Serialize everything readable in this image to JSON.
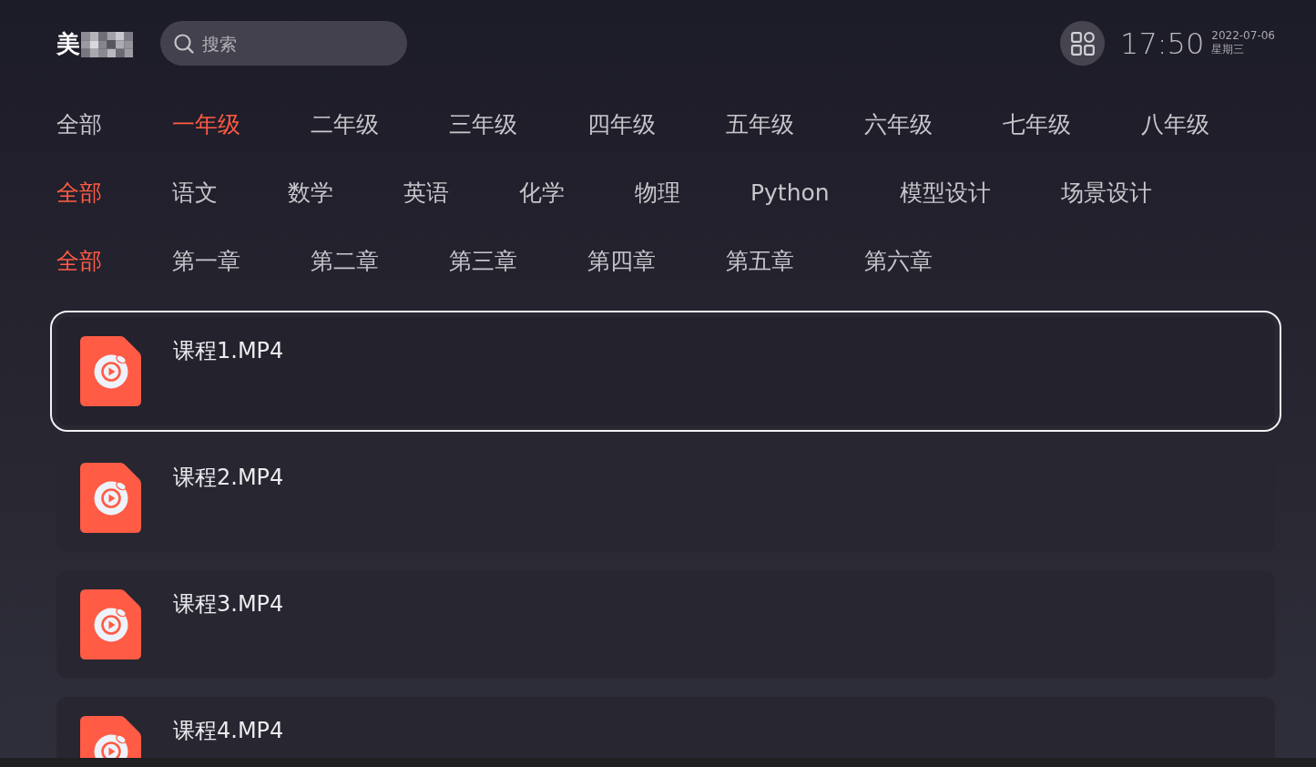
{
  "header": {
    "logo": "美",
    "search": {
      "placeholder": "搜索"
    },
    "clock": {
      "time": "17:50",
      "date": "2022-07-06",
      "weekday": "星期三"
    }
  },
  "filters": [
    {
      "items": [
        {
          "label": "全部",
          "selected": false
        },
        {
          "label": "一年级",
          "selected": true
        },
        {
          "label": "二年级",
          "selected": false
        },
        {
          "label": "三年级",
          "selected": false
        },
        {
          "label": "四年级",
          "selected": false
        },
        {
          "label": "五年级",
          "selected": false
        },
        {
          "label": "六年级",
          "selected": false
        },
        {
          "label": "七年级",
          "selected": false
        },
        {
          "label": "八年级",
          "selected": false
        }
      ]
    },
    {
      "items": [
        {
          "label": "全部",
          "selected": true
        },
        {
          "label": "语文",
          "selected": false
        },
        {
          "label": "数学",
          "selected": false
        },
        {
          "label": "英语",
          "selected": false
        },
        {
          "label": "化学",
          "selected": false
        },
        {
          "label": "物理",
          "selected": false
        },
        {
          "label": "Python",
          "selected": false
        },
        {
          "label": "模型设计",
          "selected": false
        },
        {
          "label": "场景设计",
          "selected": false
        }
      ]
    },
    {
      "items": [
        {
          "label": "全部",
          "selected": true
        },
        {
          "label": "第一章",
          "selected": false
        },
        {
          "label": "第二章",
          "selected": false
        },
        {
          "label": "第三章",
          "selected": false
        },
        {
          "label": "第四章",
          "selected": false
        },
        {
          "label": "第五章",
          "selected": false
        },
        {
          "label": "第六章",
          "selected": false
        }
      ]
    }
  ],
  "courses": [
    {
      "title": "课程1.MP4",
      "selected": true
    },
    {
      "title": "课程2.MP4",
      "selected": false
    },
    {
      "title": "课程3.MP4",
      "selected": false
    },
    {
      "title": "课程4.MP4",
      "selected": false
    }
  ]
}
